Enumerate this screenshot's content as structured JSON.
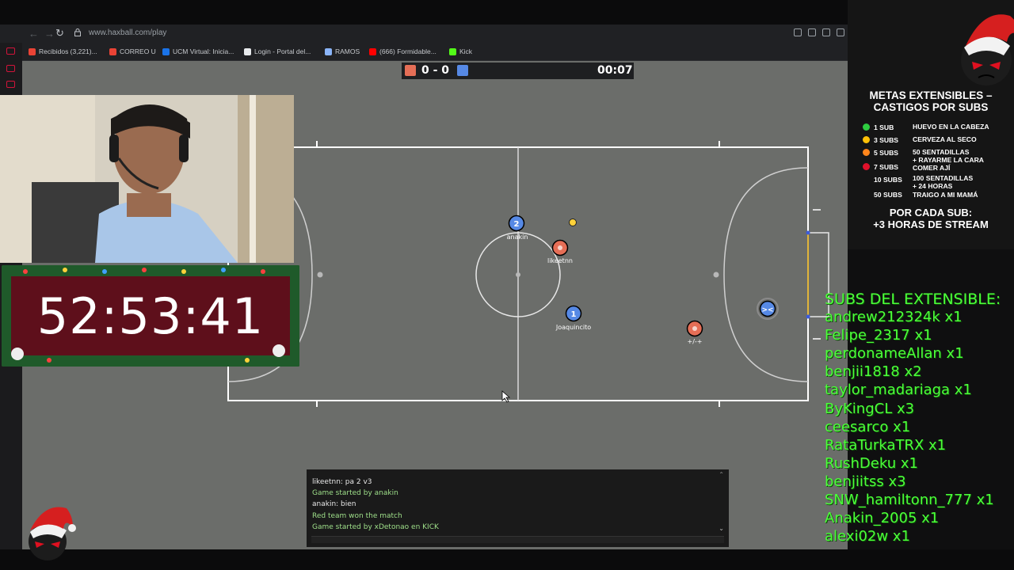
{
  "browser": {
    "url": "www.haxball.com/play",
    "bookmarks": [
      {
        "label": "Recibidos (3,221)...",
        "icon": "gmail-icon",
        "color": "#ea4335"
      },
      {
        "label": "CORREO U",
        "icon": "gmail-icon",
        "color": "#ea4335"
      },
      {
        "label": "UCM Virtual: Inicia...",
        "icon": "ucm-icon",
        "color": "#1a73e8"
      },
      {
        "label": "Login - Portal del...",
        "icon": "page-icon",
        "color": "#e8eaed"
      },
      {
        "label": "RAMOS",
        "icon": "ramos-icon",
        "color": "#8ab4f8"
      },
      {
        "label": "(666) Formidable...",
        "icon": "youtube-icon",
        "color": "#ff0000"
      },
      {
        "label": "Kick",
        "icon": "kick-icon",
        "color": "#53fc18"
      }
    ]
  },
  "game": {
    "score": "0 - 0",
    "time": "00:07",
    "red_color": "#e56e56",
    "blue_color": "#5689e5",
    "players": [
      {
        "number": "2",
        "name": "anakin",
        "team": "blue"
      },
      {
        "number": "",
        "name": "likeetnn",
        "team": "red"
      },
      {
        "number": "1",
        "name": "Joaquincito",
        "team": "blue"
      },
      {
        "number": "",
        "name": "+/-+",
        "team": "red"
      },
      {
        "number": "",
        "name": "",
        "team": "blue"
      }
    ]
  },
  "chat": {
    "lines": [
      {
        "text": "likeetnn: pa 2 v3",
        "color": "#e8e8e8"
      },
      {
        "text": "Game started by anakin",
        "color": "#9fe08a"
      },
      {
        "text": "anakin: bien",
        "color": "#e8e8e8"
      },
      {
        "text": "Red team won the match",
        "color": "#9fe08a"
      },
      {
        "text": "Game started by xDetonao en KICK",
        "color": "#9fe08a"
      }
    ]
  },
  "stream": {
    "countdown": "52:53:41",
    "panel_title_1": "METAS EXTENSIBLES –",
    "panel_title_2": "CASTIGOS POR SUBS",
    "penalties": [
      {
        "subs": "1 SUB",
        "dot": "#2ecc40",
        "desc": [
          "HUEVO EN LA CABEZA"
        ]
      },
      {
        "subs": "3 SUBS",
        "dot": "#ffc107",
        "desc": [
          "CERVEZA AL SECO"
        ]
      },
      {
        "subs": "5 SUBS",
        "dot": "#ff851b",
        "desc": [
          "50 SENTADILLAS",
          "+ RAYARME LA CARA",
          "COMER AJÍ"
        ]
      },
      {
        "subs": "7 SUBS",
        "dot": "#e0112b",
        "desc": []
      },
      {
        "subs": "10 SUBS",
        "dot": "#151515",
        "desc": [
          "100 SENTADILLAS",
          "+ 24 HORAS"
        ]
      },
      {
        "subs": "50 SUBS",
        "dot": "#151515",
        "desc": [
          "TRAIGO A MI MAMÁ"
        ]
      }
    ],
    "footer_1": "POR CADA SUB:",
    "footer_2": "+3 HORAS DE STREAM",
    "subs_title": "SUBS DEL EXTENSIBLE:",
    "subs": [
      "andrew212324k x1",
      "Felipe_2317 x1",
      "perdonameAllan x1",
      "benjii1818 x2",
      "taylor_madariaga x1",
      "ByKingCL x3",
      "ceesarco x1",
      "RataTurkaTRX x1",
      "RushDeku x1",
      "benjiitss x3",
      "SNW_hamiltonn_777 x1",
      "Anakin_2005 x1",
      "alexi02w x1"
    ]
  }
}
